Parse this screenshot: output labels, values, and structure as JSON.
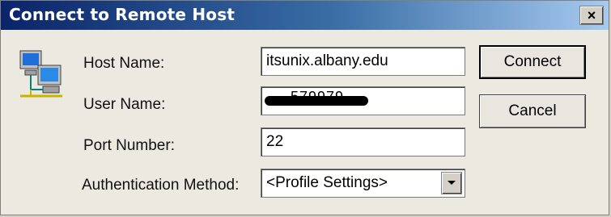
{
  "window": {
    "title": "Connect to Remote Host",
    "close_glyph": "×"
  },
  "form": {
    "host_label": "Host Name:",
    "host_value": "itsunix.albany.edu",
    "user_label": "User Name:",
    "user_value_visible_fragment": "579979",
    "port_label": "Port Number:",
    "port_value": "22",
    "auth_label": "Authentication Method:",
    "auth_value": "<Profile Settings>"
  },
  "buttons": {
    "connect": "Connect",
    "cancel": "Cancel"
  },
  "icons": {
    "host": "network-computers-icon",
    "dropdown": "chevron-down-icon"
  }
}
